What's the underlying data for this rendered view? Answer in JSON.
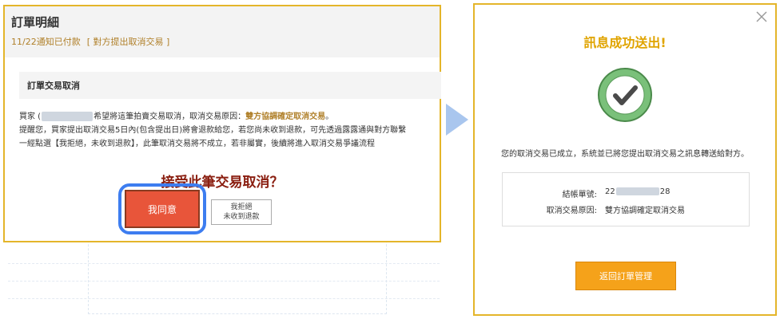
{
  "left": {
    "title": "訂單明細",
    "subtitle_date": "11/22通知已付款",
    "subtitle_tag": "[ 對方提出取消交易 ]",
    "section_title": "訂單交易取消",
    "line1_a": "買家 (",
    "line1_b": "希望將這筆拍賣交易取消，取消交易原因：",
    "line1_reason": "雙方協調確定取消交易",
    "line1_end": "。",
    "line2": "提醒您，買家提出取消交易5日內(包含提出日)將會退款給您，若您尚未收到退款，可先透過露露通與對方聯繫",
    "line3": "一經點選【我拒絕，未收到退款】，此筆取消交易將不成立，若非屬實，後續將進入取消交易爭議流程",
    "question": "接受此筆交易取消？",
    "agree_label": "我同意",
    "refuse_line1": "我拒絕",
    "refuse_line2": "未收到退款"
  },
  "right": {
    "title": "訊息成功送出!",
    "message": "您的取消交易已成立，系統並已將您提出取消交易之訊息轉送給對方。",
    "order_no_label": "結帳單號:",
    "order_no_prefix": "22",
    "order_no_suffix": "28",
    "reason_label": "取消交易原因:",
    "reason_value": "雙方協調確定取消交易",
    "return_label": "返回訂單管理"
  },
  "colors": {
    "accent_gold": "#e4b52a",
    "agree_red": "#e8553a",
    "highlight_blue": "#3d7df0",
    "success_green": "#7ac07a",
    "return_orange": "#f5a21a"
  },
  "icons": {
    "arrow": "arrow-right-icon",
    "check": "check-circle-icon",
    "close": "close-icon"
  }
}
